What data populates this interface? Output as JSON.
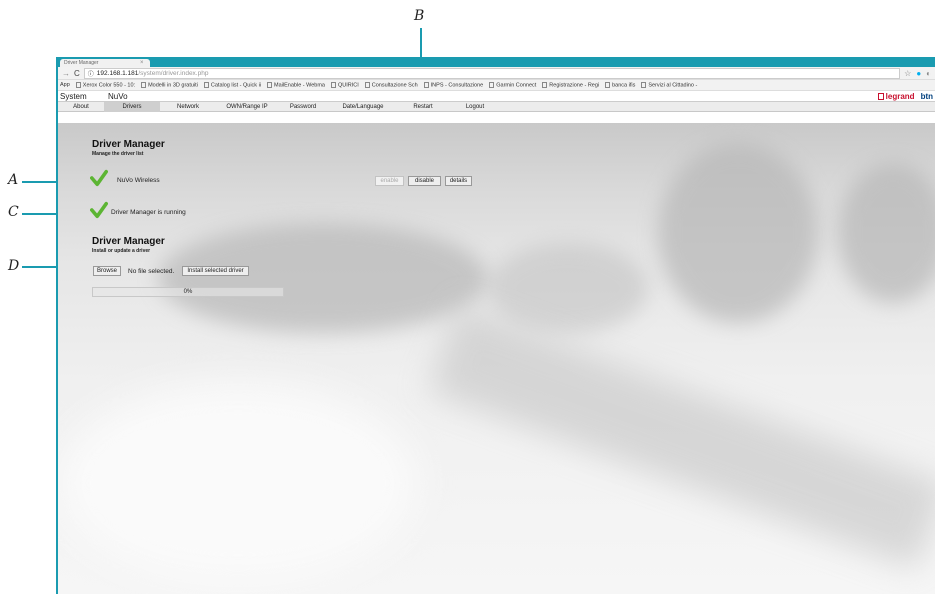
{
  "callouts": {
    "a": "A",
    "b": "B",
    "c": "C",
    "d": "D"
  },
  "browser": {
    "address": {
      "host": "192.168.1.181",
      "path": "/system/driver.index.php"
    },
    "bookmarks": [
      "App",
      "Xerox Color 550 - 10:",
      "Modelli in 3D gratuiti",
      "Catalog list - Quick ii",
      "MailEnable - Webma",
      "QUIRICI",
      "Consultazione Sch",
      "INPS - Consultazione",
      "Garmin Connect",
      "Registrazione - Regi",
      "banca ifis",
      "Servizi al Cittadino -"
    ]
  },
  "app": {
    "system_label": "System",
    "device_label": "NuVo",
    "brand": "legrand",
    "brand_suffix": "btn",
    "menu": [
      "About",
      "Drivers",
      "Network",
      "OWN/Range IP",
      "Password",
      "Date/Language",
      "Restart",
      "Logout"
    ],
    "active_menu": "Drivers"
  },
  "driver_list": {
    "title": "Driver Manager",
    "subtitle": "Manage the driver list",
    "driver_name": "NuVo Wireless",
    "enable_label": "enable",
    "disable_label": "disable",
    "details_label": "details",
    "status_text": "Driver Manager is running"
  },
  "installer": {
    "title": "Driver Manager",
    "subtitle": "Install or update a driver",
    "browse_label": "Browse",
    "file_status": "No file selected.",
    "install_label": "Install selected driver",
    "progress_text": "0%",
    "progress_value": 0
  },
  "colors": {
    "accent": "#1a9bb0",
    "check": "#5cb533",
    "brand_red": "#c8102e"
  }
}
